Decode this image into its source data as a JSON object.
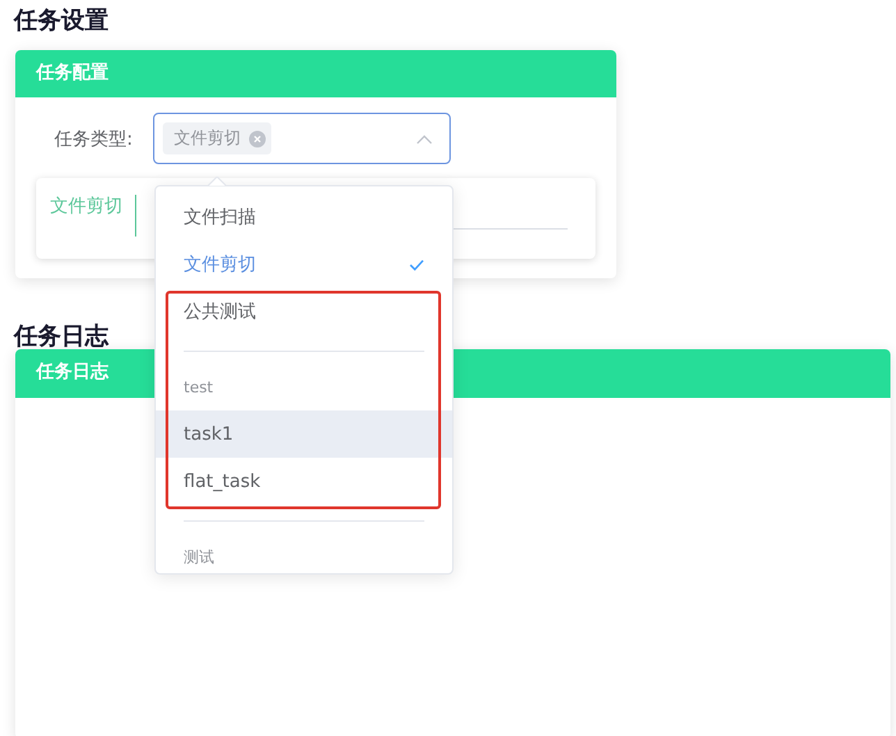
{
  "sections": [
    {
      "title": "任务设置",
      "card_title": "任务配置"
    },
    {
      "title": "任务日志",
      "card_title": "任务日志"
    }
  ],
  "task_type": {
    "label": "任务类型:",
    "tags": [
      {
        "label": "文件剪切"
      }
    ],
    "expanded": true
  },
  "task_card": {
    "label": "文件剪切"
  },
  "dropdown": {
    "groups": [
      {
        "options": [
          {
            "label": "文件扫描",
            "selected": false,
            "hovered": false
          },
          {
            "label": "文件剪切",
            "selected": true,
            "hovered": false
          },
          {
            "label": "公共测试",
            "selected": false,
            "hovered": false
          }
        ]
      },
      {
        "label": "test",
        "options": [
          {
            "label": "task1",
            "selected": false,
            "hovered": true
          },
          {
            "label": "flat_task",
            "selected": false,
            "hovered": false
          }
        ]
      },
      {
        "label": "测试"
      }
    ]
  }
}
